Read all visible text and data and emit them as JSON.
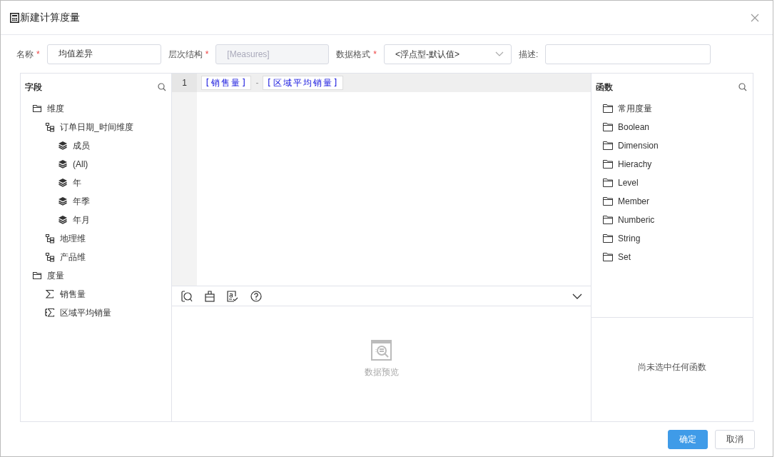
{
  "window": {
    "title": "新建计算度量"
  },
  "form": {
    "name": {
      "label": "名称",
      "required_mark": "*",
      "value": "均值差异"
    },
    "hierarchy": {
      "label": "层次结构",
      "required_mark": "*",
      "value": "[Measures]",
      "disabled": true
    },
    "format": {
      "label": "数据格式",
      "required_mark": "*",
      "value": "<浮点型-默认值>"
    },
    "description": {
      "label": "描述:"
    }
  },
  "fields": {
    "title": "字段",
    "tree": [
      {
        "kind": "folder",
        "label": "维度",
        "children": [
          {
            "kind": "hierarchy",
            "label": "订单日期_时间维度",
            "children": [
              {
                "kind": "level",
                "label": "成员"
              },
              {
                "kind": "level",
                "label": "(All)"
              },
              {
                "kind": "level",
                "label": "年"
              },
              {
                "kind": "level",
                "label": "年季"
              },
              {
                "kind": "level",
                "label": "年月"
              }
            ]
          },
          {
            "kind": "hierarchy",
            "label": "地理维"
          },
          {
            "kind": "hierarchy",
            "label": "产品维"
          }
        ]
      },
      {
        "kind": "folder",
        "label": "度量",
        "children": [
          {
            "kind": "measure",
            "label": "销售量"
          },
          {
            "kind": "calc-measure",
            "label": "区域平均销量"
          }
        ]
      }
    ]
  },
  "editor": {
    "line_number": "1",
    "tokens": [
      {
        "kind": "field",
        "text": "[销售量]"
      },
      {
        "kind": "operator",
        "text": "-"
      },
      {
        "kind": "field",
        "text": "[区域平均销量]"
      }
    ],
    "preview": {
      "label": "数据预览"
    }
  },
  "functions": {
    "title": "函数",
    "items": [
      "常用度量",
      "Boolean",
      "Dimension",
      "Hierachy",
      "Level",
      "Member",
      "Numberic",
      "String",
      "Set"
    ],
    "info": "尚未选中任何函数"
  },
  "buttons": [
    {
      "kind": "primary",
      "label": "确定"
    },
    {
      "kind": "secondary",
      "label": "取消"
    }
  ]
}
